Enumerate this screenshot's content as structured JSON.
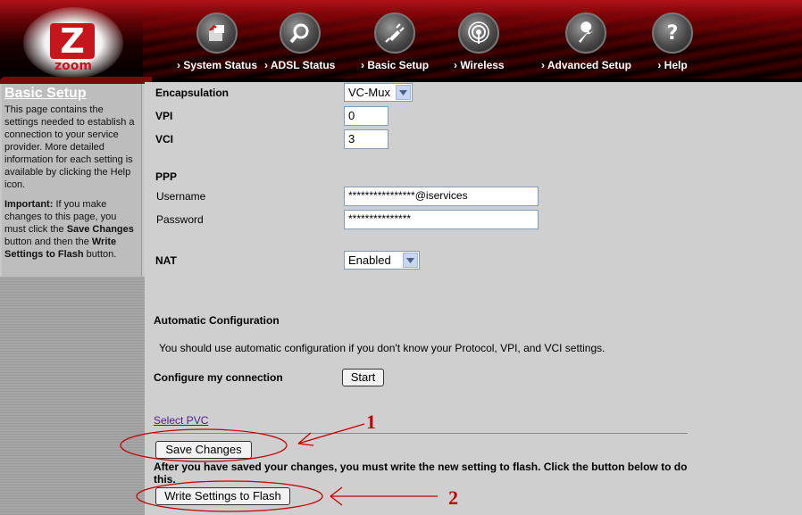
{
  "header": {
    "logo_text": "zoom",
    "nav": [
      {
        "label": "› System Status",
        "icon": "system-status-icon"
      },
      {
        "label": "› ADSL Status",
        "icon": "magnifier-icon"
      },
      {
        "label": "› Basic Setup",
        "icon": "plug-icon"
      },
      {
        "label": "› Wireless",
        "icon": "wireless-icon"
      },
      {
        "label": "› Advanced Setup",
        "icon": "wrench-icon"
      },
      {
        "label": "› Help",
        "icon": "question-icon"
      }
    ]
  },
  "sidebar": {
    "title": "Basic Setup",
    "description": "This page contains the settings needed to establish a connection to your service provider. More detailed information for each setting is available by clicking the Help icon.",
    "important_label": "Important:",
    "important_text_1": " If you make changes to this page, you must click the ",
    "save_bold": "Save Changes",
    "important_text_2": " button and then the ",
    "write_bold": "Write Settings to Flash",
    "important_text_3": " button."
  },
  "form": {
    "encapsulation_label": "Encapsulation",
    "encapsulation_value": "VC-Mux",
    "vpi_label": "VPI",
    "vpi_value": "0",
    "vci_label": "VCI",
    "vci_value": "3",
    "ppp_label": "PPP",
    "username_label": "Username",
    "username_value": "****************@iservices",
    "password_label": "Password",
    "password_value": "***************",
    "nat_label": "NAT",
    "nat_value": "Enabled",
    "auto_config_label": "Automatic Configuration",
    "auto_config_text": "You should use automatic configuration if you don't know your Protocol, VPI, and VCI settings.",
    "configure_label": "Configure my connection",
    "start_button": "Start",
    "select_pvc_link": "Select PVC",
    "save_button": "Save Changes",
    "flash_note": "After you have saved your changes, you must write the new setting to flash. Click the button below to do this.",
    "write_button": "Write Settings to Flash"
  },
  "annotations": {
    "marker_1": "1",
    "marker_2": "2",
    "color": "#c00000"
  }
}
